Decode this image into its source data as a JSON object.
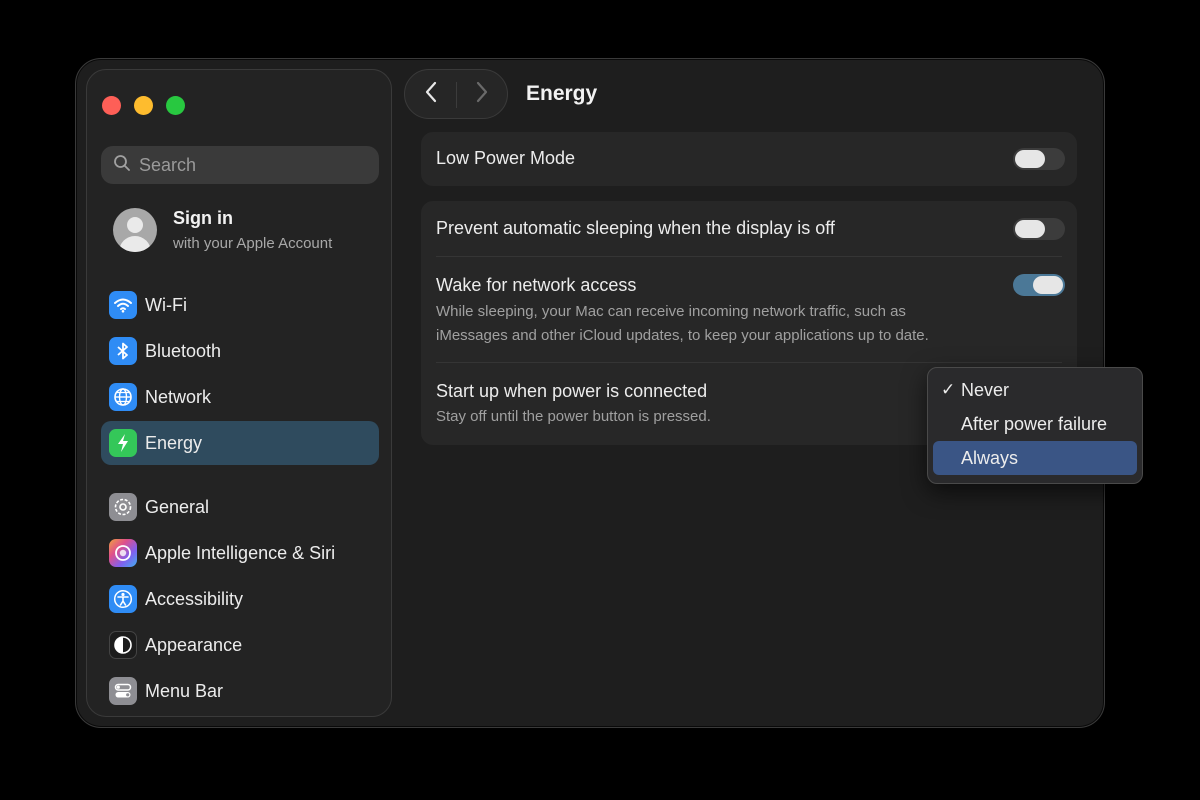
{
  "window": {
    "traffic_lights": [
      "close",
      "minimize",
      "zoom"
    ],
    "colors": {
      "close": "#fe5f57",
      "minimize": "#febc2e",
      "zoom": "#28c840"
    }
  },
  "sidebar": {
    "search": {
      "placeholder": "Search"
    },
    "account": {
      "title": "Sign in",
      "subtitle": "with your Apple Account"
    },
    "items": [
      {
        "label": "Wi-Fi",
        "icon": "wifi-icon",
        "color": "#2f8cf5",
        "selected": false
      },
      {
        "label": "Bluetooth",
        "icon": "bluetooth-icon",
        "color": "#2f8cf5",
        "selected": false
      },
      {
        "label": "Network",
        "icon": "globe-icon",
        "color": "#2f8cf5",
        "selected": false
      },
      {
        "label": "Energy",
        "icon": "bolt-icon",
        "color": "#34c759",
        "selected": true
      },
      {
        "label": "General",
        "icon": "gear-icon",
        "color": "#8e8e93",
        "selected": false
      },
      {
        "label": "Apple Intelligence & Siri",
        "icon": "siri-icon",
        "color": "#c060e0",
        "selected": false
      },
      {
        "label": "Accessibility",
        "icon": "accessibility-icon",
        "color": "#2f8cf5",
        "selected": false
      },
      {
        "label": "Appearance",
        "icon": "appearance-icon",
        "color": "#1c1c1c",
        "selected": false
      },
      {
        "label": "Menu Bar",
        "icon": "menubar-icon",
        "color": "#8e8e93",
        "selected": false
      }
    ]
  },
  "header": {
    "title": "Energy"
  },
  "settings": {
    "low_power": {
      "label": "Low Power Mode",
      "enabled": false
    },
    "prevent_sleep": {
      "label": "Prevent automatic sleeping when the display is off",
      "enabled": false
    },
    "wake_network": {
      "label": "Wake for network access",
      "description_line1": "While sleeping, your Mac can receive incoming network traffic, such as",
      "description_line2": "iMessages and other iCloud updates, to keep your applications up to date.",
      "enabled": true
    },
    "startup_power": {
      "label": "Start up when power is connected",
      "description": "Stay off until the power button is pressed."
    }
  },
  "dropdown": {
    "options": [
      {
        "label": "Never",
        "checked": true,
        "highlighted": false
      },
      {
        "label": "After power failure",
        "checked": false,
        "highlighted": false
      },
      {
        "label": "Always",
        "checked": false,
        "highlighted": true
      }
    ],
    "check_glyph": "✓"
  }
}
